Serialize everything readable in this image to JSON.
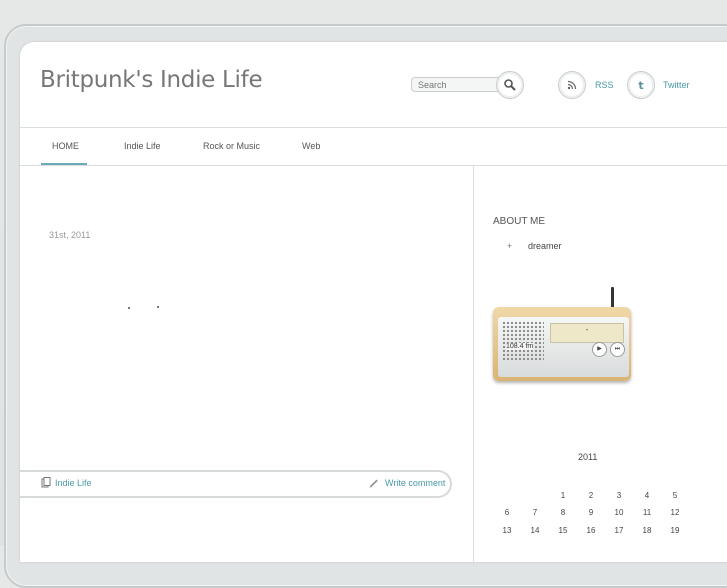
{
  "site": {
    "title": "Britpunk's Indie Life"
  },
  "search": {
    "placeholder": "Search"
  },
  "header_links": {
    "rss": "RSS",
    "twitter": "Twitter"
  },
  "nav": [
    "HOME",
    "Indie Life",
    "Rock or Music",
    "Web"
  ],
  "post": {
    "date": "31st, 2011",
    "category": "Indie Life",
    "comment_link": "Write comment"
  },
  "sidebar": {
    "about_heading": "ABOUT ME",
    "bullet": "+",
    "about_item": "dreamer",
    "radio": {
      "screen_text": "-",
      "frequency": "108.4 fm"
    }
  },
  "calendar": {
    "year": "2011",
    "rows": [
      [
        "",
        "",
        "1",
        "2",
        "3",
        "4",
        "5"
      ],
      [
        "6",
        "7",
        "8",
        "9",
        "10",
        "11",
        "12"
      ],
      [
        "13",
        "14",
        "15",
        "16",
        "17",
        "18",
        "19"
      ]
    ]
  },
  "colors": {
    "accent": "#4a9aa8",
    "nav_underline": "#6aaab8"
  },
  "icons": {
    "search": "search-icon",
    "rss": "rss-icon",
    "twitter": "twitter-icon",
    "document": "document-icon",
    "pencil": "pencil-icon"
  }
}
